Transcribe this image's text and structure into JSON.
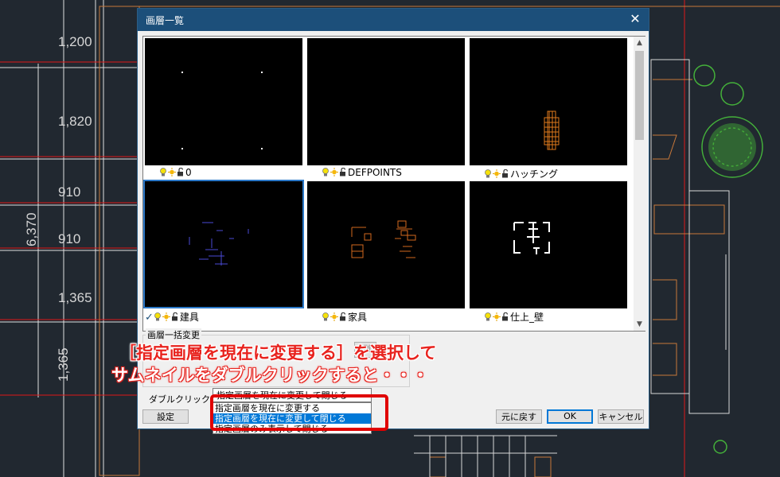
{
  "cad": {
    "dimensions": [
      "1,200",
      "1,820",
      "910",
      "910",
      "1,365",
      "1,365"
    ],
    "total_dimension": "6,370"
  },
  "dialog": {
    "title": "画層一覧",
    "close_icon": "close-icon"
  },
  "layers": [
    {
      "name": "0",
      "checked": false
    },
    {
      "name": "DEFPOINTS",
      "checked": false
    },
    {
      "name": "ハッチング",
      "checked": false
    },
    {
      "name": "建具",
      "checked": true
    },
    {
      "name": "家具",
      "checked": false
    },
    {
      "name": "仕上_壁",
      "checked": false
    }
  ],
  "layer_icons": [
    "bulb-icon",
    "sun-icon",
    "lock-icon"
  ],
  "bulk_change": {
    "label": "画層一括変更",
    "button_fragment": "(別"
  },
  "double_click": {
    "label": "ダブルクリック:",
    "selected_value": "指定画層を現在に変更して閉じる",
    "options": [
      "指定画層を現在に変更する",
      "指定画層を現在に変更して閉じる",
      "指定画層のみ表示して閉じる"
    ],
    "highlighted_index": 1
  },
  "buttons": {
    "settings": "設定",
    "restore": "元に戻す",
    "ok": "OK",
    "cancel": "キャンセル"
  },
  "annotation": {
    "line1": "［指定画層を現在に変更する］を選択して",
    "line2": "サムネイルをダブルクリックすると・・・"
  },
  "colors": {
    "cad_background": "#212830",
    "title_bar": "#1c4f7a",
    "selection": "#0078d7",
    "annotation_red": "#e8231e"
  }
}
